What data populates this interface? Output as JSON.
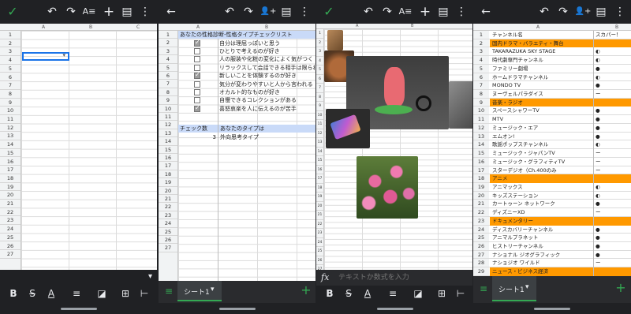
{
  "icons": {
    "confirm": "✓",
    "undo": "↶",
    "redo": "↷",
    "text_format": "A≡",
    "add": "+",
    "comment": "▤",
    "more": "⋮",
    "back": "←",
    "add_person": "👤+",
    "bold": "B",
    "strike": "S",
    "text_color": "A",
    "align": "≡",
    "fill": "◪",
    "merge": "⊞",
    "insert_col": "⊢",
    "sheets_list": "≡",
    "add_sheet": "+",
    "fx": "fx",
    "dropdown": "▾"
  },
  "colors": {
    "toolbar": "#202124",
    "accent_green": "#34a853",
    "header_blue": "#c9daf8",
    "orange": "#ff9900"
  },
  "panel1": {
    "columns": [
      "A",
      "B",
      "C"
    ],
    "rows": [
      "1",
      "2",
      "3",
      "4",
      "5",
      "6",
      "7",
      "8",
      "9",
      "10",
      "11",
      "12",
      "13",
      "14",
      "15",
      "16",
      "17",
      "18",
      "19",
      "20",
      "21",
      "22",
      "23",
      "24",
      "25",
      "26",
      "27"
    ]
  },
  "panel2": {
    "columns": [
      "A",
      "B"
    ],
    "title": "あなたの性格診断-性格タイプチェックリスト",
    "items": [
      {
        "checked": true,
        "text": "自分は理屈っぽいと思う"
      },
      {
        "checked": false,
        "text": "ひとりで考えるのが好き"
      },
      {
        "checked": false,
        "text": "人の服装や化粧の変化によく気がつく"
      },
      {
        "checked": false,
        "text": "リラックスして会話できる相手は限られて"
      },
      {
        "checked": true,
        "text": "新しいことを体験するのが好き"
      },
      {
        "checked": false,
        "text": "気分が変わりやすいと人から言われる"
      },
      {
        "checked": false,
        "text": "オカルト的なものが好き"
      },
      {
        "checked": false,
        "text": "自慢できるコレクションがある"
      },
      {
        "checked": true,
        "text": "喜怒哀楽を人に伝えるのが苦手"
      }
    ],
    "check_count_label": "チェック数",
    "result_label": "あなたのタイプは",
    "count": "3",
    "result": "外向思考タイプ",
    "rows": [
      "1",
      "2",
      "3",
      "4",
      "5",
      "6",
      "7",
      "8",
      "9",
      "10",
      "11",
      "12",
      "13",
      "14",
      "15",
      "16",
      "17",
      "18",
      "19",
      "20",
      "21",
      "22",
      "23",
      "24",
      "25",
      "26",
      "27"
    ],
    "sheet_tab": "シート1"
  },
  "panel3": {
    "columns": [
      "A",
      "B"
    ],
    "formula_placeholder": "テキストか数式を入力",
    "rows": [
      "1",
      "2",
      "3",
      "4",
      "5",
      "6",
      "7",
      "8",
      "9",
      "10",
      "11",
      "12",
      "13",
      "14",
      "15",
      "16",
      "17",
      "18",
      "19",
      "20",
      "21",
      "22",
      "23",
      "24",
      "25",
      "26",
      "27"
    ]
  },
  "panel4": {
    "columns": [
      "A",
      "B"
    ],
    "sheet_tab": "シート1",
    "rows": [
      {
        "n": "1",
        "name": "チャンネル名",
        "mark": "スカパー！",
        "type": "header"
      },
      {
        "n": "2",
        "name": "国内ドラマ・バラエティ・舞台",
        "mark": "",
        "type": "cat"
      },
      {
        "n": "3",
        "name": "TAKARAZUKA SKY STAGE",
        "mark": "◐",
        "type": "item"
      },
      {
        "n": "4",
        "name": "時代劇専門チャンネル",
        "mark": "◐",
        "type": "item"
      },
      {
        "n": "5",
        "name": "ファミリー劇場",
        "mark": "●",
        "type": "item"
      },
      {
        "n": "6",
        "name": "ホームドラマチャンネル",
        "mark": "◐",
        "type": "item"
      },
      {
        "n": "7",
        "name": "MONDO TV",
        "mark": "●",
        "type": "item"
      },
      {
        "n": "8",
        "name": "ヌーヴェルパラダイス",
        "mark": "ー",
        "type": "item"
      },
      {
        "n": "9",
        "name": "音楽・ラジオ",
        "mark": "",
        "type": "cat"
      },
      {
        "n": "10",
        "name": "スペースシャワーTV",
        "mark": "●",
        "type": "item"
      },
      {
        "n": "11",
        "name": "MTV",
        "mark": "●",
        "type": "item"
      },
      {
        "n": "12",
        "name": "ミュージック・エア",
        "mark": "●",
        "type": "item"
      },
      {
        "n": "13",
        "name": "エムオン!",
        "mark": "●",
        "type": "item"
      },
      {
        "n": "14",
        "name": "歌謡ポップスチャンネル",
        "mark": "◐",
        "type": "item"
      },
      {
        "n": "15",
        "name": "ミュージック・ジャパンTV",
        "mark": "ー",
        "type": "item"
      },
      {
        "n": "16",
        "name": "ミュージック・グラフィティTV",
        "mark": "ー",
        "type": "item"
      },
      {
        "n": "17",
        "name": "スターデジオ（Ch.400のみ",
        "mark": "ー",
        "type": "item"
      },
      {
        "n": "18",
        "name": "アニメ",
        "mark": "",
        "type": "cat"
      },
      {
        "n": "19",
        "name": "アニマックス",
        "mark": "◐",
        "type": "item"
      },
      {
        "n": "20",
        "name": "キッズステーション",
        "mark": "◐",
        "type": "item"
      },
      {
        "n": "21",
        "name": "カートゥーン ネットワーク",
        "mark": "●",
        "type": "item"
      },
      {
        "n": "22",
        "name": "ディズニーXD",
        "mark": "ー",
        "type": "item"
      },
      {
        "n": "23",
        "name": "ドキュメンタリー",
        "mark": "",
        "type": "cat"
      },
      {
        "n": "24",
        "name": "ディスカバリーチャンネル",
        "mark": "●",
        "type": "item"
      },
      {
        "n": "25",
        "name": "アニマルプラネット",
        "mark": "●",
        "type": "item"
      },
      {
        "n": "26",
        "name": "ヒストリーチャンネル",
        "mark": "●",
        "type": "item"
      },
      {
        "n": "27",
        "name": "ナショナル ジオグラフィック",
        "mark": "●",
        "type": "item"
      },
      {
        "n": "28",
        "name": "ナショジオ ワイルド",
        "mark": "ー",
        "type": "item"
      },
      {
        "n": "29",
        "name": "ニュース・ビジネス経済",
        "mark": "",
        "type": "cat"
      }
    ]
  }
}
